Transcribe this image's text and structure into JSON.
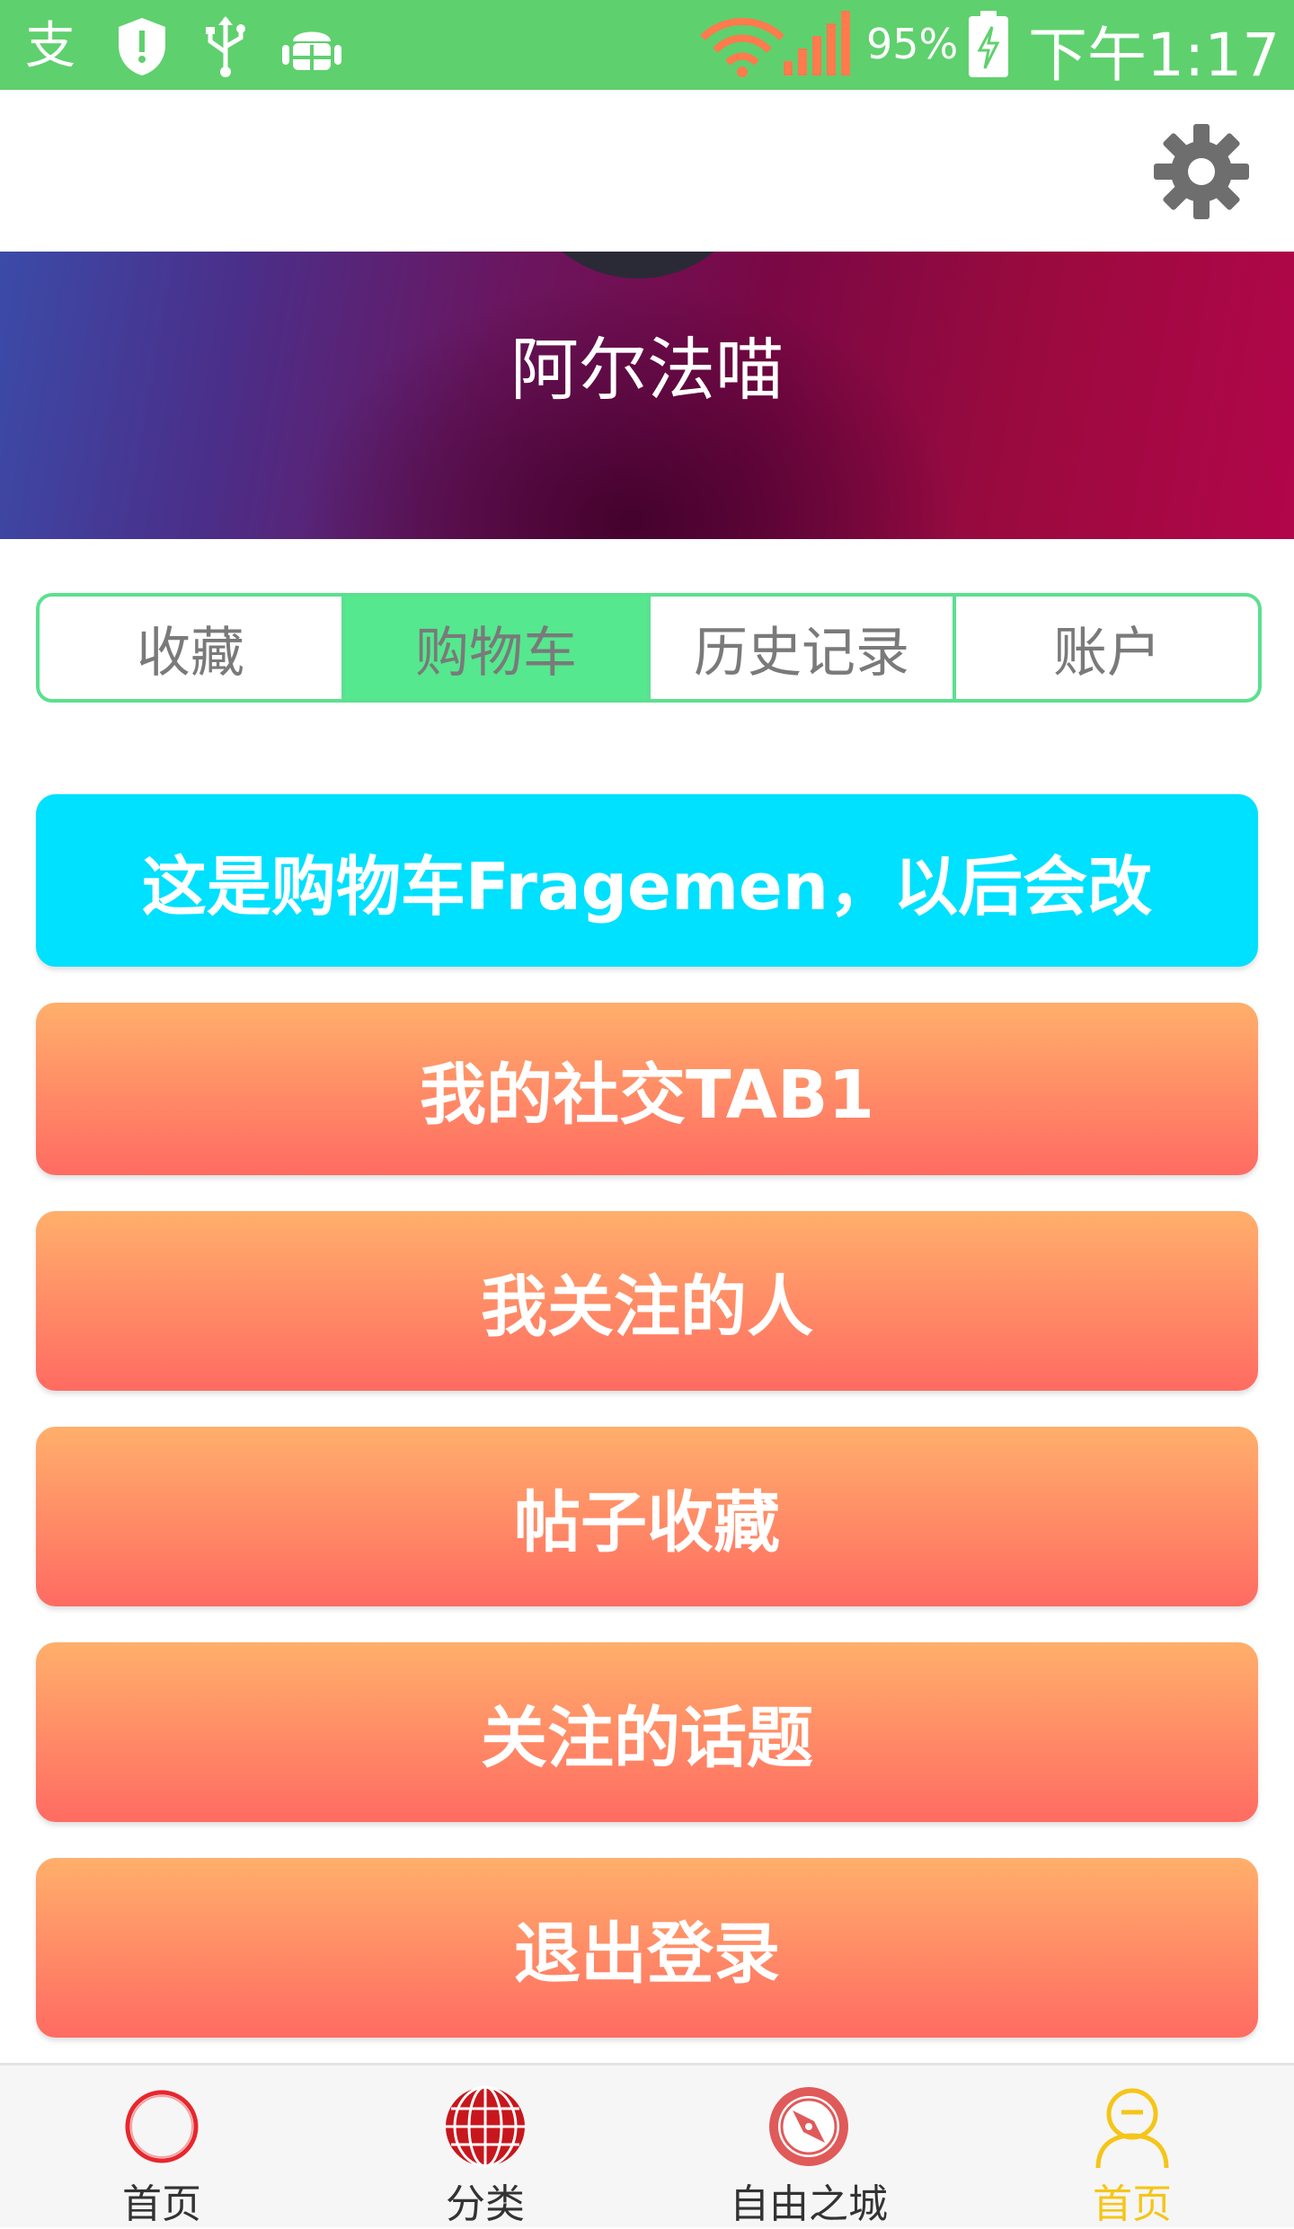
{
  "status_bar": {
    "battery": "95%",
    "time": "下午1:17",
    "icons": [
      "alipay-icon",
      "shield-alert-icon",
      "usb-icon",
      "android-debug-icon",
      "wifi-icon",
      "signal-icon",
      "battery-charging-icon"
    ]
  },
  "toolbar": {
    "settings_icon": "gear-icon"
  },
  "profile": {
    "username": "阿尔法喵"
  },
  "tabs": [
    {
      "label": "收藏",
      "active": false
    },
    {
      "label": "购物车",
      "active": true
    },
    {
      "label": "历史记录",
      "active": false
    },
    {
      "label": "账户",
      "active": false
    }
  ],
  "content": {
    "banner_text": "这是购物车Fragemen，以后会改",
    "buttons": [
      {
        "label": "我的社交TAB1"
      },
      {
        "label": "我关注的人"
      },
      {
        "label": "帖子收藏"
      },
      {
        "label": "关注的话题"
      },
      {
        "label": "退出登录"
      }
    ]
  },
  "bottom_nav": [
    {
      "label": "首页",
      "icon": "circle-icon",
      "color": "#e8262d"
    },
    {
      "label": "分类",
      "icon": "globe-icon",
      "color": "#c8161d"
    },
    {
      "label": "自由之城",
      "icon": "compass-icon",
      "color": "#e05a5a"
    },
    {
      "label": "首页",
      "icon": "user-icon",
      "color": "#f5c518",
      "active": true
    }
  ],
  "colors": {
    "status_bar": "#5fd06e",
    "tab_accent": "#55e88e",
    "banner": "#00e0ff",
    "button_top": "#ffaf6b",
    "button_bottom": "#ff6b62",
    "nav_active": "#f5c518"
  }
}
